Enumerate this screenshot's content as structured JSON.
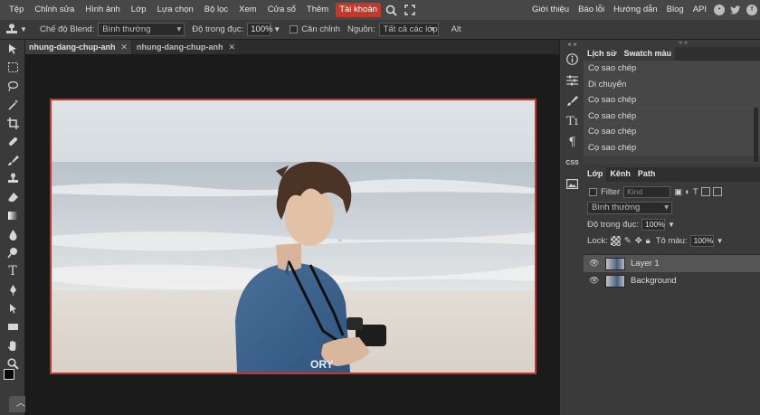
{
  "menubar": {
    "items": [
      "Tệp",
      "Chỉnh sửa",
      "Hình ảnh",
      "Lớp",
      "Lựa chọn",
      "Bộ lọc",
      "Xem",
      "Cửa sổ",
      "Thêm",
      "Tài khoản"
    ],
    "right_items": [
      "Giới thiệu",
      "Báo lỗi",
      "Hướng dẫn",
      "Blog",
      "API"
    ],
    "accent_color": "#c0392b"
  },
  "options": {
    "blend_label": "Chế độ Blend:",
    "blend_value": "Bình thường",
    "opacity_label": "Độ trong đục:",
    "opacity_value": "100%",
    "align_label": "Căn chỉnh",
    "source_label": "Nguồn:",
    "source_value": "Tất cả các lớp",
    "alt_label": "Alt"
  },
  "tabs": [
    {
      "label": "nhung-dang-chup-anh"
    },
    {
      "label": "nhung-dang-chup-anh"
    }
  ],
  "strip": {
    "css_label": "CSS"
  },
  "history_panel": {
    "tabs": [
      "Lịch sử",
      "Swatch màu"
    ],
    "items": [
      "Cọ sao chép",
      "Di chuyển",
      "Cọ sao chép",
      "Cọ sao chép",
      "Cọ sao chép",
      "Cọ sao chép"
    ]
  },
  "layers_panel": {
    "tabs": [
      "Lớp",
      "Kênh",
      "Path"
    ],
    "filter_label": "Filter",
    "filter_placeholder": "Kind",
    "blend_value": "Bình thường",
    "opacity_label": "Độ trong đục:",
    "opacity_value": "100%",
    "lock_label": "Lock:",
    "fill_label": "Tô màu:",
    "fill_value": "100%",
    "layers": [
      "Layer 1",
      "Background"
    ]
  }
}
